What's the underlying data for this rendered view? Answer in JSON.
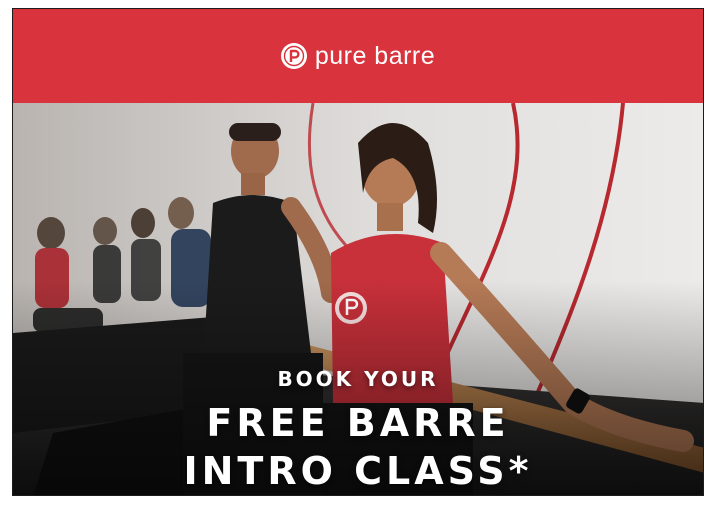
{
  "brand": {
    "name": "pure barre",
    "logo_icon": "pure-barre-p-icon",
    "bar_color": "#d9343d"
  },
  "headline": {
    "line1": "BOOK YOUR",
    "line2": "FREE BARRE",
    "line3": "INTRO CLASS*"
  },
  "hero_image": {
    "icon": "barre-class-photo"
  }
}
